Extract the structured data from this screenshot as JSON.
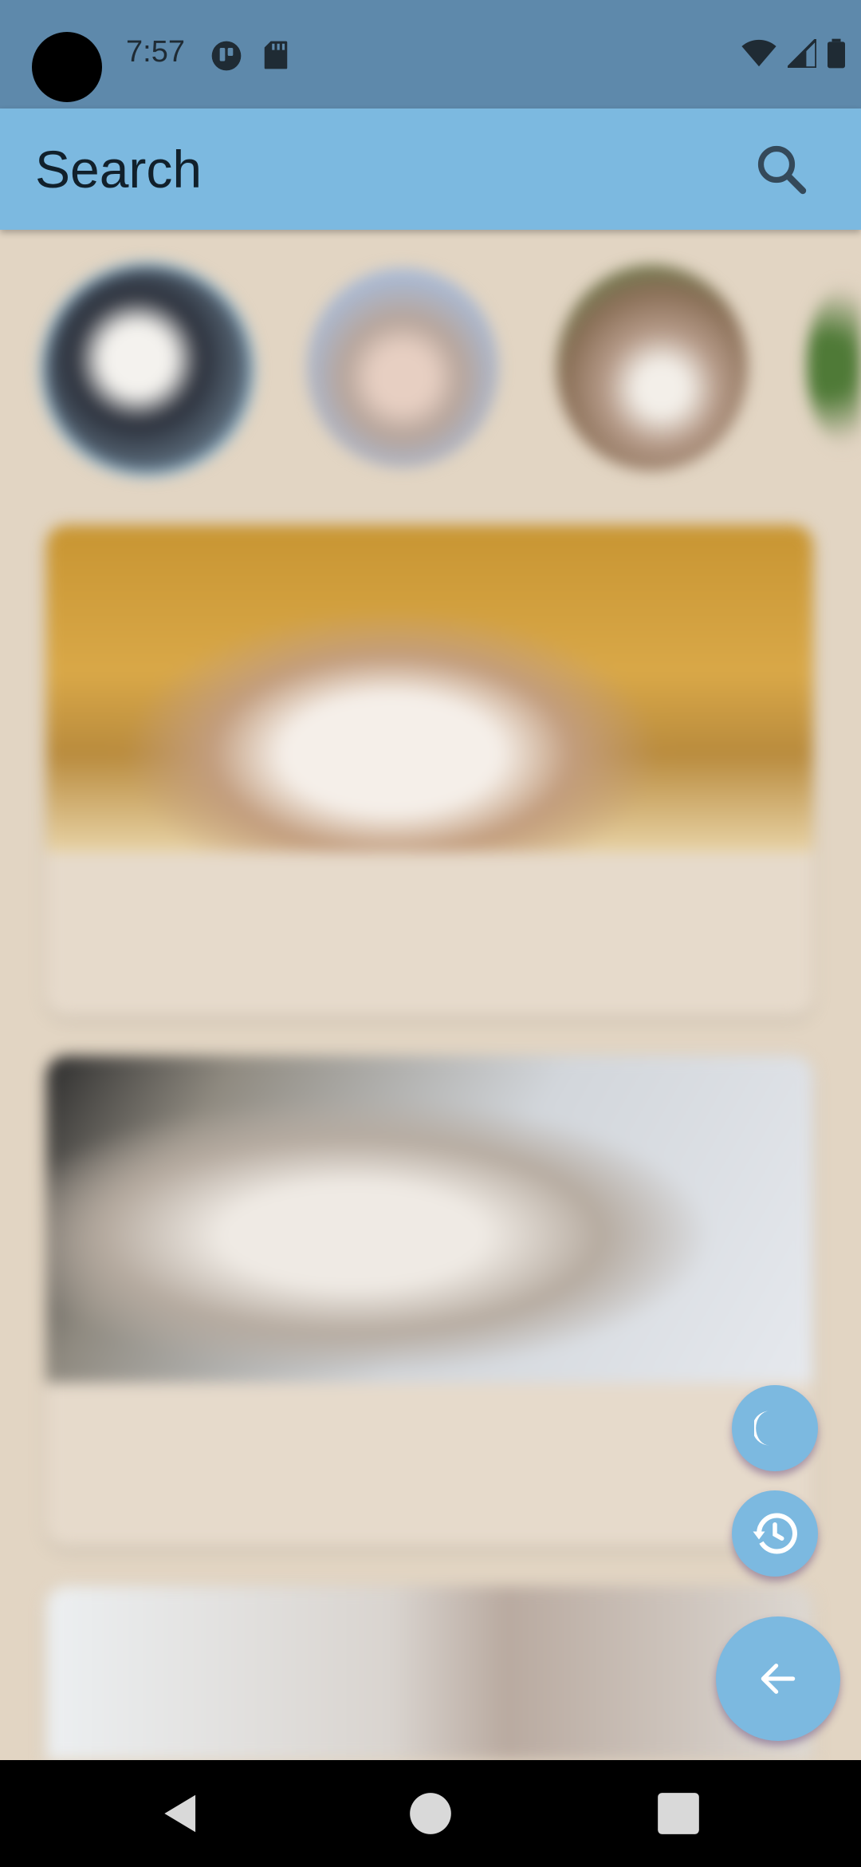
{
  "status_bar": {
    "time": "7:57",
    "icons_left": [
      "tile-icon",
      "sd-card-icon"
    ],
    "icons_right": [
      "wifi-icon",
      "signal-icon",
      "battery-icon"
    ]
  },
  "app_bar": {
    "title": "Search",
    "action_icon": "search-icon"
  },
  "stories": [
    {
      "name": "story-1"
    },
    {
      "name": "story-2"
    },
    {
      "name": "story-3"
    },
    {
      "name": "story-4"
    }
  ],
  "cards": [
    {
      "title": "",
      "meta_left": "",
      "meta_right": ""
    },
    {
      "title": "",
      "meta_left": "",
      "meta_right": ""
    },
    {
      "title": "",
      "meta_left": "",
      "meta_right": ""
    }
  ],
  "fabs": {
    "theme_icon": "moon-icon",
    "history_icon": "history-icon",
    "back_icon": "arrow-left-icon"
  },
  "nav_bar": {
    "buttons": [
      "back-triangle-icon",
      "home-circle-icon",
      "recents-square-icon"
    ]
  },
  "colors": {
    "status_bar": "#5e89ab",
    "app_bar": "#7cb9e0",
    "background": "#e2d5c3",
    "fab": "#7cb9e0",
    "nav_bar": "#000000"
  }
}
